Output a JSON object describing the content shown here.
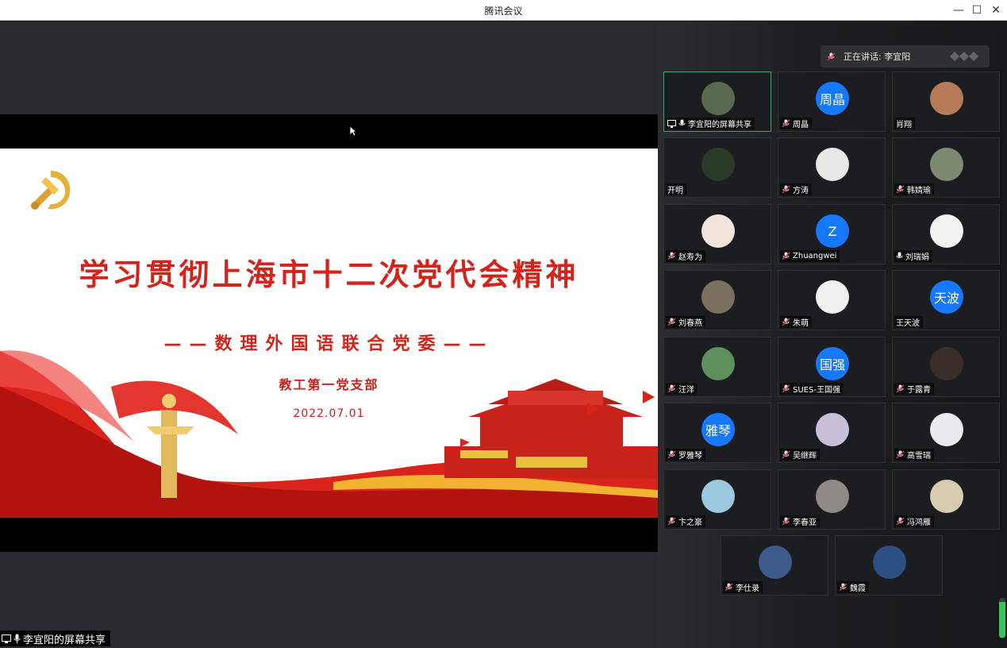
{
  "window": {
    "title": "腾讯会议"
  },
  "slide": {
    "title": "学习贯彻上海市十二次党代会精神",
    "subtitle": "——数理外国语联合党委——",
    "branch": "教工第一党支部",
    "date": "2022.07.01"
  },
  "share_label": "李宜阳的屏幕共享",
  "speaking": {
    "text": "正在讲话: 李宜阳"
  },
  "participants": [
    {
      "name": "李宜阳的屏幕共享",
      "avatar_text": "",
      "avatar_color": "#5a6a50",
      "mic": "on",
      "active": true,
      "share_icon": true
    },
    {
      "name": "周晶",
      "avatar_text": "周晶",
      "avatar_color": "#1677ff",
      "mic": "off"
    },
    {
      "name": "肖翔",
      "avatar_text": "",
      "avatar_color": "#b57a58",
      "mic": "none"
    },
    {
      "name": "开明",
      "avatar_text": "",
      "avatar_color": "#2c3a2a",
      "mic": "none"
    },
    {
      "name": "方涛",
      "avatar_text": "",
      "avatar_color": "#e8e8e8",
      "mic": "off"
    },
    {
      "name": "韩婧瑜",
      "avatar_text": "",
      "avatar_color": "#7c8a70",
      "mic": "off"
    },
    {
      "name": "赵寿为",
      "avatar_text": "",
      "avatar_color": "#f0e4dc",
      "mic": "off"
    },
    {
      "name": "Zhuangwei",
      "avatar_text": "Z",
      "avatar_color": "#1677ff",
      "mic": "off"
    },
    {
      "name": "刘瑞娟",
      "avatar_text": "",
      "avatar_color": "#f2f2f2",
      "mic": "on"
    },
    {
      "name": "刘春燕",
      "avatar_text": "",
      "avatar_color": "#7a7060",
      "mic": "off"
    },
    {
      "name": "朱萌",
      "avatar_text": "",
      "avatar_color": "#f0f0f0",
      "mic": "off"
    },
    {
      "name": "王天波",
      "avatar_text": "天波",
      "avatar_color": "#1677ff",
      "mic": "none"
    },
    {
      "name": "汪洋",
      "avatar_text": "",
      "avatar_color": "#5f8f5a",
      "mic": "off"
    },
    {
      "name": "SUES-王国强",
      "avatar_text": "国强",
      "avatar_color": "#1677ff",
      "mic": "off"
    },
    {
      "name": "于露青",
      "avatar_text": "",
      "avatar_color": "#3a2e2a",
      "mic": "off"
    },
    {
      "name": "罗雅琴",
      "avatar_text": "雅琴",
      "avatar_color": "#1677ff",
      "mic": "off"
    },
    {
      "name": "吴继辉",
      "avatar_text": "",
      "avatar_color": "#c8c0d8",
      "mic": "off"
    },
    {
      "name": "高雪瑞",
      "avatar_text": "",
      "avatar_color": "#eaeaf0",
      "mic": "off"
    },
    {
      "name": "卞之豪",
      "avatar_text": "",
      "avatar_color": "#9cc8e0",
      "mic": "off"
    },
    {
      "name": "李春亚",
      "avatar_text": "",
      "avatar_color": "#908a86",
      "mic": "off"
    },
    {
      "name": "冯鸿雁",
      "avatar_text": "",
      "avatar_color": "#d8ccb0",
      "mic": "off"
    },
    {
      "name": "李仕录",
      "avatar_text": "",
      "avatar_color": "#3c5a8c",
      "mic": "off"
    },
    {
      "name": "魏霞",
      "avatar_text": "",
      "avatar_color": "#2a4f80",
      "mic": "off"
    }
  ],
  "audio_level": 0.9,
  "colors": {
    "accent": "#1677ff",
    "slide_red": "#d4231b",
    "active_border": "#2fa86b"
  }
}
